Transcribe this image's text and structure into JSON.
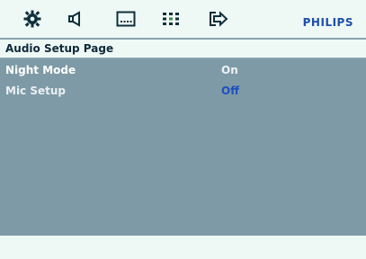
{
  "toolbar": {
    "icons": [
      "gear-icon",
      "speaker-icon",
      "subtitle-icon",
      "grid-icon",
      "exit-arrow-icon"
    ],
    "brand": "PHILIPS",
    "brand_color": "#1e4fa8"
  },
  "page": {
    "title": "Audio Setup Page"
  },
  "menu": {
    "rows": [
      {
        "label": "Night Mode",
        "value": "On",
        "label_color": "#ffffff",
        "value_color": "#eef2f4",
        "selected": true
      },
      {
        "label": "Mic Setup",
        "value": "Off",
        "label_color": "#e9f0f3",
        "value_color": "#1f4fbf",
        "selected": false
      }
    ]
  },
  "colors": {
    "background_light": "#eef8f5",
    "content_gray": "#7e9aa6",
    "separator": "#8aa4b0"
  }
}
